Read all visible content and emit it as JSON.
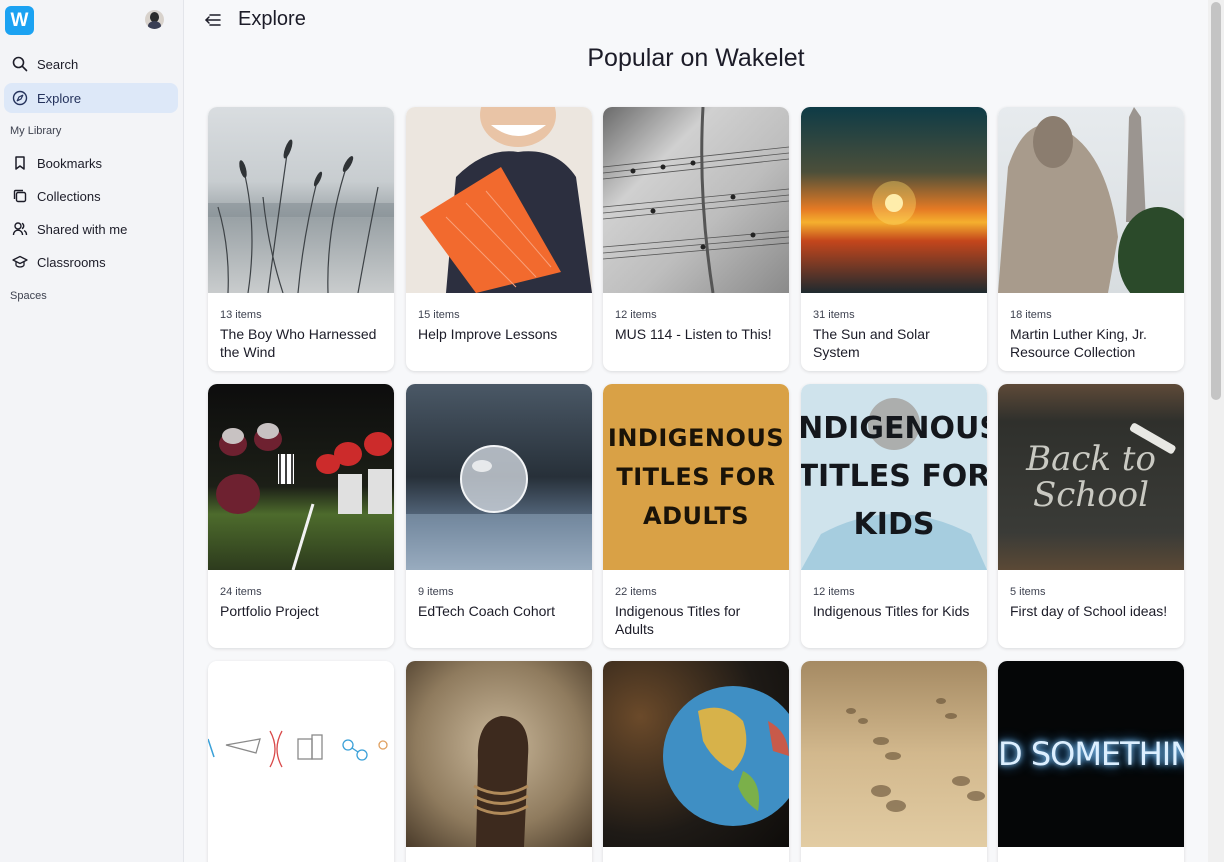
{
  "app": {
    "logo_text": "W",
    "page_title": "Explore"
  },
  "sidebar": {
    "nav": [
      {
        "label": "Search",
        "icon": "search-icon"
      },
      {
        "label": "Explore",
        "icon": "compass-icon",
        "active": true
      }
    ],
    "my_library_label": "My Library",
    "library": [
      {
        "label": "Bookmarks",
        "icon": "bookmark-icon"
      },
      {
        "label": "Collections",
        "icon": "collections-icon"
      },
      {
        "label": "Shared with me",
        "icon": "shared-users-icon"
      },
      {
        "label": "Classrooms",
        "icon": "graduation-cap-icon"
      }
    ],
    "spaces_label": "Spaces"
  },
  "main": {
    "heading": "Popular on Wakelet",
    "cards": [
      {
        "count": "13 items",
        "title": "The Boy Who Harnessed the Wind",
        "image": "grass-field"
      },
      {
        "count": "15 items",
        "title": "Help Improve Lessons",
        "image": "woman-orange-folder"
      },
      {
        "count": "12 items",
        "title": "MUS 114 - Listen to This!",
        "image": "sheet-music"
      },
      {
        "count": "31 items",
        "title": "The Sun and Solar System",
        "image": "sunset"
      },
      {
        "count": "18 items",
        "title": "Martin Luther King, Jr. Resource Collection",
        "image": "mlk-memorial"
      },
      {
        "count": "24 items",
        "title": "Portfolio Project",
        "image": "football-game"
      },
      {
        "count": "9 items",
        "title": "EdTech Coach Cohort",
        "image": "frozen-bubble"
      },
      {
        "count": "22 items",
        "title": "Indigenous Titles for Adults",
        "image": "indigenous-adults",
        "image_text": "INDIGENOUS TITLES FOR ADULTS"
      },
      {
        "count": "12 items",
        "title": "Indigenous Titles for Kids",
        "image": "indigenous-kids",
        "image_text": "INDIGENOUS TITLES FOR KIDS"
      },
      {
        "count": "5 items",
        "title": "First day of School ideas!",
        "image": "chalkboard",
        "image_text": "Back to School"
      },
      {
        "count": "",
        "title": "",
        "image": "science-icons"
      },
      {
        "count": "",
        "title": "",
        "image": "raised-fist"
      },
      {
        "count": "",
        "title": "",
        "image": "globe"
      },
      {
        "count": "",
        "title": "",
        "image": "footprints"
      },
      {
        "count": "",
        "title": "",
        "image": "neon-sign",
        "image_text": "D SOMETHING GRE"
      }
    ]
  },
  "colors": {
    "brand": "#1ba2f2",
    "active_nav_bg": "#dde8f8"
  }
}
